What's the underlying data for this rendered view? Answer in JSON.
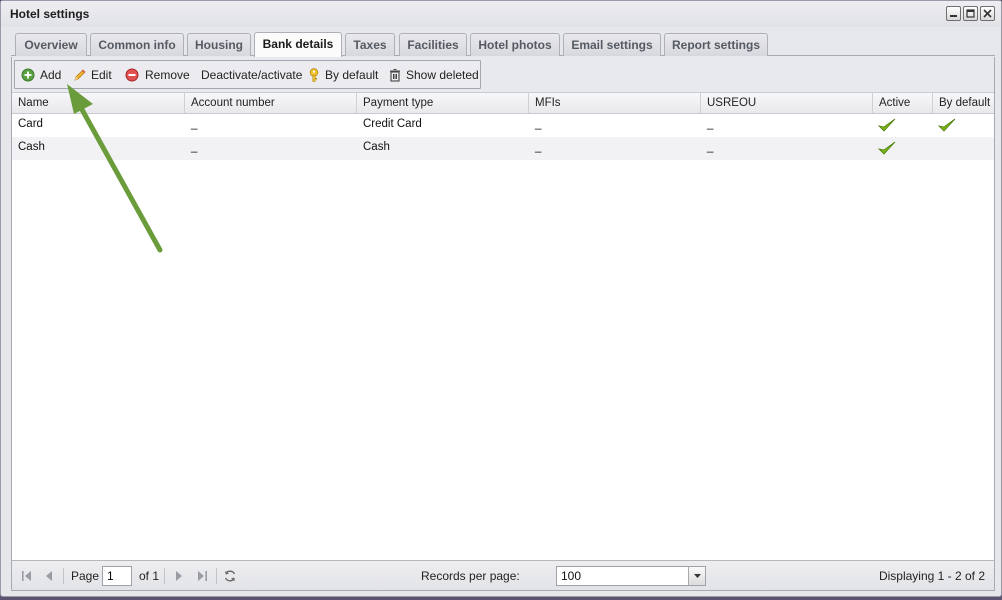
{
  "window": {
    "title": "Hotel settings"
  },
  "tabs": [
    {
      "label": "Overview"
    },
    {
      "label": "Common info"
    },
    {
      "label": "Housing"
    },
    {
      "label": "Bank details",
      "active": true
    },
    {
      "label": "Taxes"
    },
    {
      "label": "Facilities"
    },
    {
      "label": "Hotel photos"
    },
    {
      "label": "Email settings"
    },
    {
      "label": "Report settings"
    }
  ],
  "toolbar": {
    "add": "Add",
    "edit": "Edit",
    "remove": "Remove",
    "deactivate": "Deactivate/activate",
    "by_default": "By default",
    "show_deleted": "Show deleted"
  },
  "grid": {
    "columns": [
      "Name",
      "Account number",
      "Payment type",
      "MFIs",
      "USREOU",
      "Active",
      "By default"
    ],
    "rows": [
      {
        "name": "Card",
        "account": "_",
        "payment_type": "Credit Card",
        "mfis": "_",
        "usreou": "_",
        "active": true,
        "by_default": true
      },
      {
        "name": "Cash",
        "account": "_",
        "payment_type": "Cash",
        "mfis": "_",
        "usreou": "_",
        "active": true,
        "by_default": false
      }
    ]
  },
  "pager": {
    "page_label": "Page",
    "page_value": "1",
    "of_label": "of 1",
    "records_label": "Records per page:",
    "records_value": "100",
    "display_info": "Displaying 1 - 2 of 2"
  },
  "colors": {
    "arrow": "#6a9c3c",
    "check": "#7cb518"
  }
}
